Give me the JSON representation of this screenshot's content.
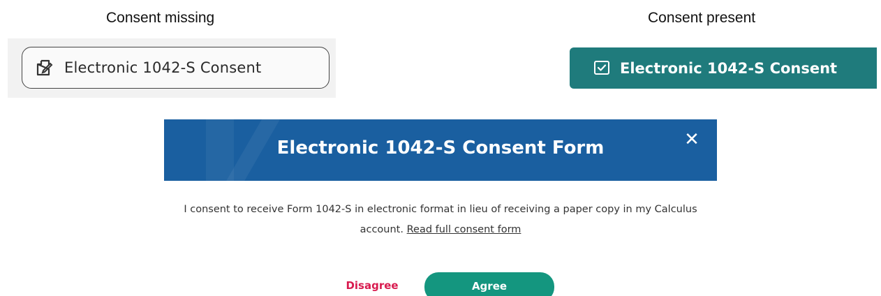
{
  "captions": {
    "missing": "Consent missing",
    "present": "Consent present"
  },
  "consent_missing_button": {
    "label": "Electronic 1042-S Consent",
    "icon": "edit-document-icon"
  },
  "consent_present_button": {
    "label": "Electronic 1042-S Consent",
    "icon": "checked-box-icon"
  },
  "modal": {
    "title": "Electronic 1042-S Consent Form",
    "close_icon": "close-icon",
    "body_text": "I consent to receive Form 1042-S in electronic format in lieu of receiving a paper copy in my Calculus account.",
    "link_text": "Read full consent form",
    "disagree_label": "Disagree",
    "agree_label": "Agree"
  },
  "colors": {
    "present_button_bg": "#1f7b7c",
    "modal_header_bg": "#1a5fa0",
    "agree_bg": "#14967f",
    "disagree_text": "#d81b4f"
  }
}
